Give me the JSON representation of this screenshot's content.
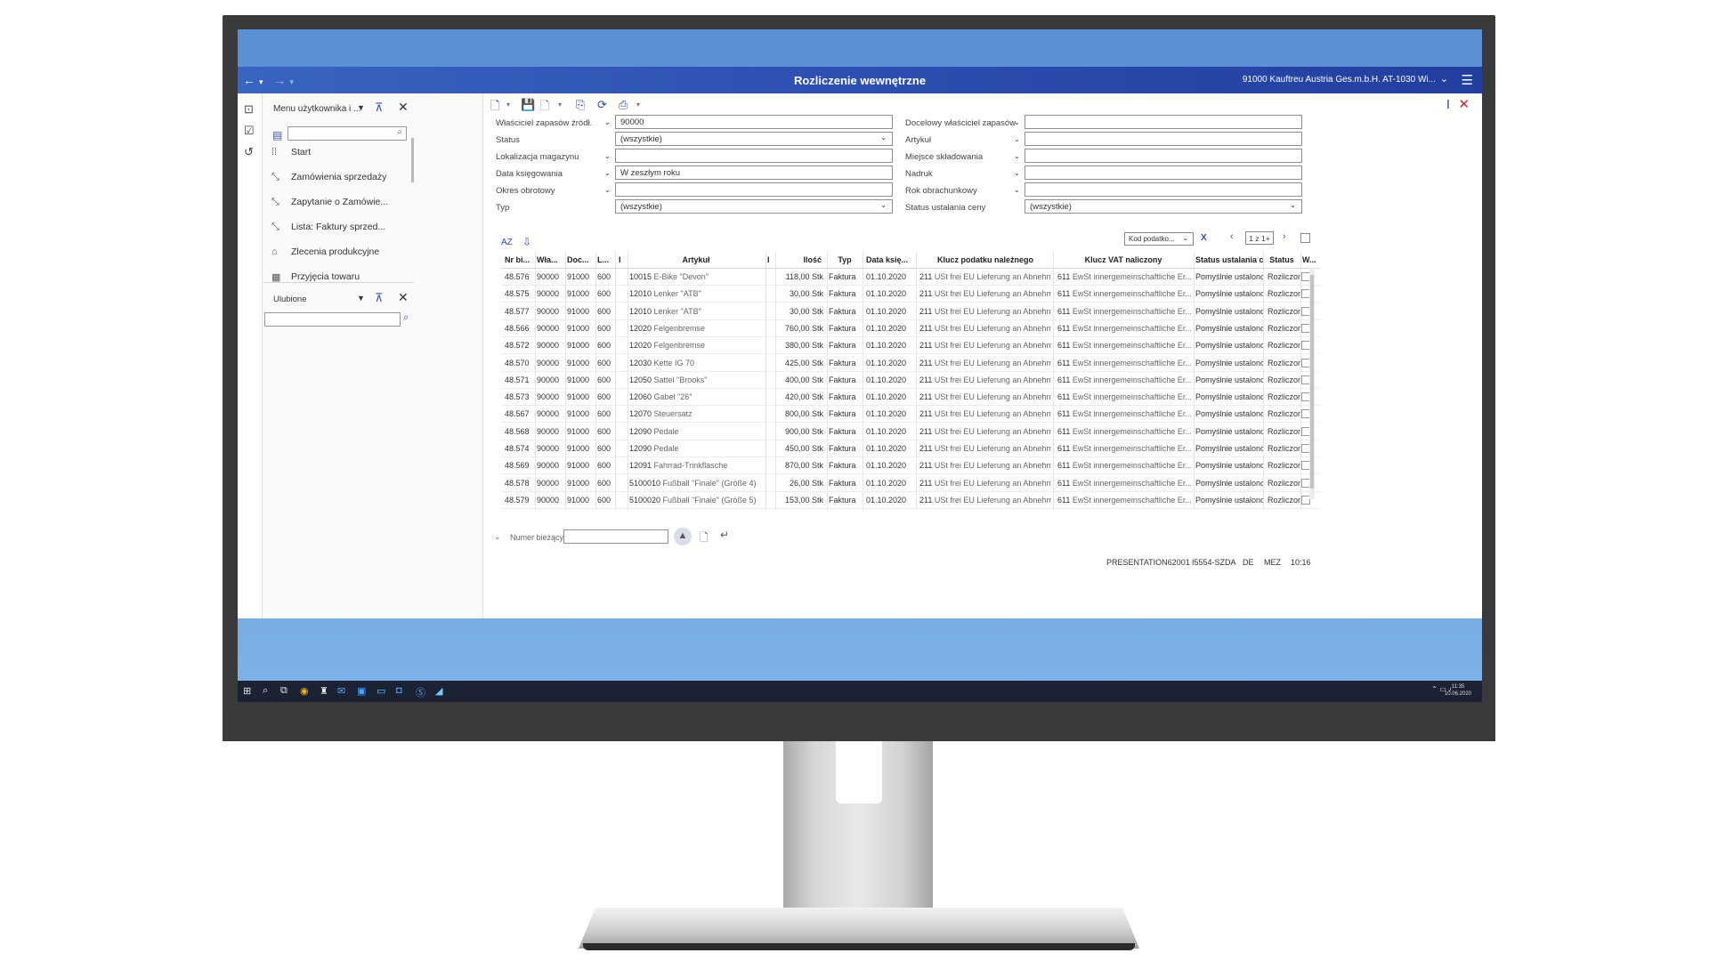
{
  "window": {
    "title": "Rozliczenie wewnętrzne",
    "company": "91000  Kauftreu Austria Ges.m.b.H. AT-1030 Wi..."
  },
  "left_panel": {
    "menu_header": "Menu użytkownika i ...",
    "items": [
      {
        "label": "Start",
        "icon": "grid-dots-icon"
      },
      {
        "label": "Zamówienia sprzedaży",
        "icon": "expand-icon"
      },
      {
        "label": "Zapytanie o Zamówie...",
        "icon": "expand-icon"
      },
      {
        "label": "Lista: Faktury sprzed...",
        "icon": "expand-icon"
      },
      {
        "label": "Zlecenia produkcyjne",
        "icon": "factory-icon"
      },
      {
        "label": "Przyjęcia towaru",
        "icon": "table-icon"
      }
    ],
    "favorites_header": "Ulubione"
  },
  "form": {
    "left": [
      {
        "label": "Właściciel zapasów źródł.",
        "value": "90000",
        "dropdown": false
      },
      {
        "label": "Status",
        "value": "(wszystkie)",
        "dropdown": true
      },
      {
        "label": "Lokalizacja magazynu",
        "value": "",
        "dropdown": false
      },
      {
        "label": "Data księgowania",
        "value": "W zeszłym roku",
        "dropdown": false
      },
      {
        "label": "Okres obrotowy",
        "value": "",
        "dropdown": false
      },
      {
        "label": "Typ",
        "value": "(wszystkie)",
        "dropdown": true
      }
    ],
    "right": [
      {
        "label": "Docelowy właściciel zapasów",
        "value": "",
        "dropdown": false
      },
      {
        "label": "Artykuł",
        "value": "",
        "dropdown": false
      },
      {
        "label": "Miejsce składowania",
        "value": "",
        "dropdown": false
      },
      {
        "label": "Nadruk",
        "value": "",
        "dropdown": false
      },
      {
        "label": "Rok obrachunkowy",
        "value": "",
        "dropdown": false
      },
      {
        "label": "Status ustalania ceny",
        "value": "(wszystkie)",
        "dropdown": true
      }
    ]
  },
  "grid_toolbar": {
    "sort_label": "AZ",
    "column_select": "Kod podatko...",
    "page": "1 z 1+"
  },
  "table": {
    "columns": [
      "Nr bi...",
      "Wła...",
      "Doc...",
      "L...",
      "I",
      "Artykuł",
      "I",
      "Ilość",
      "Typ",
      "Data księ...",
      "Klucz podatku należnego",
      "Klucz VAT naliczony",
      "Status ustalania c...",
      "Status",
      "W..."
    ],
    "rows": [
      [
        "48.576",
        "90000",
        "91000",
        "600",
        "10015",
        "E-Bike \"Devon\"",
        "118,00 Stk",
        "Faktura",
        "01.10.2020",
        "211",
        "USt frei EU Lieferung an Abnehm...",
        "611",
        "EwSt innergemeinschaftliche Er...",
        "Pomyślnie ustalono",
        "Rozliczone"
      ],
      [
        "48.575",
        "90000",
        "91000",
        "600",
        "12010",
        "Lenker \"ATB\"",
        "30,00 Stk",
        "Faktura",
        "01.10.2020",
        "211",
        "USt frei EU Lieferung an Abnehm...",
        "611",
        "EwSt innergemeinschaftliche Er...",
        "Pomyślnie ustalono",
        "Rozliczone"
      ],
      [
        "48.577",
        "90000",
        "91000",
        "600",
        "12010",
        "Lenker \"ATB\"",
        "30,00 Stk",
        "Faktura",
        "01.10.2020",
        "211",
        "USt frei EU Lieferung an Abnehm...",
        "611",
        "EwSt innergemeinschaftliche Er...",
        "Pomyślnie ustalono",
        "Rozliczone"
      ],
      [
        "48.566",
        "90000",
        "91000",
        "600",
        "12020",
        "Felgenbremse",
        "760,00 Stk",
        "Faktura",
        "01.10.2020",
        "211",
        "USt frei EU Lieferung an Abnehm...",
        "611",
        "EwSt innergemeinschaftliche Er...",
        "Pomyślnie ustalono",
        "Rozliczone"
      ],
      [
        "48.572",
        "90000",
        "91000",
        "600",
        "12020",
        "Felgenbremse",
        "380,00 Stk",
        "Faktura",
        "01.10.2020",
        "211",
        "USt frei EU Lieferung an Abnehm...",
        "611",
        "EwSt innergemeinschaftliche Er...",
        "Pomyślnie ustalono",
        "Rozliczone"
      ],
      [
        "48.570",
        "90000",
        "91000",
        "600",
        "12030",
        "Kette IG 70",
        "425,00 Stk",
        "Faktura",
        "01.10.2020",
        "211",
        "USt frei EU Lieferung an Abnehm...",
        "611",
        "EwSt innergemeinschaftliche Er...",
        "Pomyślnie ustalono",
        "Rozliczone"
      ],
      [
        "48.571",
        "90000",
        "91000",
        "600",
        "12050",
        "Sattel \"Brooks\"",
        "400,00 Stk",
        "Faktura",
        "01.10.2020",
        "211",
        "USt frei EU Lieferung an Abnehm...",
        "611",
        "EwSt innergemeinschaftliche Er...",
        "Pomyślnie ustalono",
        "Rozliczone"
      ],
      [
        "48.573",
        "90000",
        "91000",
        "600",
        "12060",
        "Gabel \"26\"",
        "420,00 Stk",
        "Faktura",
        "01.10.2020",
        "211",
        "USt frei EU Lieferung an Abnehm...",
        "611",
        "EwSt innergemeinschaftliche Er...",
        "Pomyślnie ustalono",
        "Rozliczone"
      ],
      [
        "48.567",
        "90000",
        "91000",
        "600",
        "12070",
        "Steuersatz",
        "800,00 Stk",
        "Faktura",
        "01.10.2020",
        "211",
        "USt frei EU Lieferung an Abnehm...",
        "611",
        "EwSt innergemeinschaftliche Er...",
        "Pomyślnie ustalono",
        "Rozliczone"
      ],
      [
        "48.568",
        "90000",
        "91000",
        "600",
        "12090",
        "Pedale",
        "900,00 Stk",
        "Faktura",
        "01.10.2020",
        "211",
        "USt frei EU Lieferung an Abnehm...",
        "611",
        "EwSt innergemeinschaftliche Er...",
        "Pomyślnie ustalono",
        "Rozliczone"
      ],
      [
        "48.574",
        "90000",
        "91000",
        "600",
        "12090",
        "Pedale",
        "450,00 Stk",
        "Faktura",
        "01.10.2020",
        "211",
        "USt frei EU Lieferung an Abnehm...",
        "611",
        "EwSt innergemeinschaftliche Er...",
        "Pomyślnie ustalono",
        "Rozliczone"
      ],
      [
        "48.569",
        "90000",
        "91000",
        "600",
        "12091",
        "Fahrrad-Trinkflasche",
        "870,00 Stk",
        "Faktura",
        "01.10.2020",
        "211",
        "USt frei EU Lieferung an Abnehm...",
        "611",
        "EwSt innergemeinschaftliche Er...",
        "Pomyślnie ustalono",
        "Rozliczone"
      ],
      [
        "48.578",
        "90000",
        "91000",
        "600",
        "5100010",
        "Fußball \"Finale\" (Größe 4)",
        "26,00 Stk",
        "Faktura",
        "01.10.2020",
        "211",
        "USt frei EU Lieferung an Abnehm...",
        "611",
        "EwSt innergemeinschaftliche Er...",
        "Pomyślnie ustalono",
        "Rozliczone"
      ],
      [
        "48.579",
        "90000",
        "91000",
        "600",
        "5100020",
        "Fußball \"Finale\" (Größe 5)",
        "153,00 Stk",
        "Faktura",
        "01.10.2020",
        "211",
        "USt frei EU Lieferung an Abnehm...",
        "611",
        "EwSt innergemeinschaftliche Er...",
        "Pomyślnie ustalono",
        "Rozliczone"
      ]
    ]
  },
  "bottom": {
    "current_number_label": "Numer bieżący"
  },
  "statusbar": {
    "user": "PRESENTATION62001",
    "session": "I5554-SZDA",
    "lang": "DE",
    "tz": "MEZ",
    "time": "10:16"
  },
  "taskbar": {
    "clock_time": "11:35",
    "clock_date": "10.06.2020"
  },
  "colors": {
    "titlebar": "#2c4fb1",
    "accent": "#2c4fb1",
    "close": "#dd2222"
  }
}
